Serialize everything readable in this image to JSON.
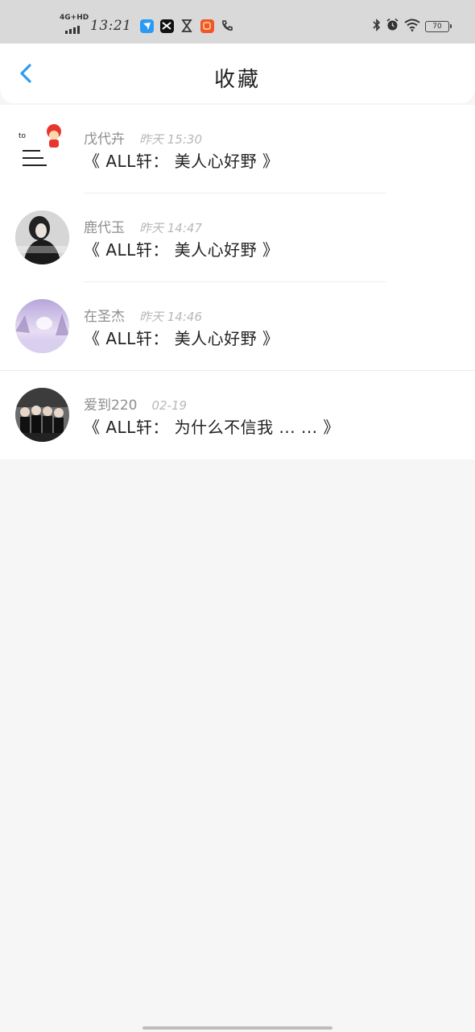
{
  "status_bar": {
    "network": "4G+HD",
    "time": "13:21",
    "battery": "70"
  },
  "header": {
    "title": "收藏"
  },
  "favorites": [
    {
      "author": "戊代卉",
      "time": "昨天 15:30",
      "title": "《 ALL轩： 美人心好野 》"
    },
    {
      "author": "鹿代玉",
      "time": "昨天 14:47",
      "title": "《 ALL轩： 美人心好野 》"
    },
    {
      "author": "在圣杰",
      "time": "昨天 14:46",
      "title": "《 ALL轩： 美人心好野 》"
    },
    {
      "author": "爱到220",
      "time": "02-19",
      "title": "《 ALL轩： 为什么不信我 ... ... 》"
    }
  ],
  "colors": {
    "accent": "#2f9cee",
    "status_bar_bg": "#d9d9d9",
    "page_bg": "#f7f6f6"
  }
}
